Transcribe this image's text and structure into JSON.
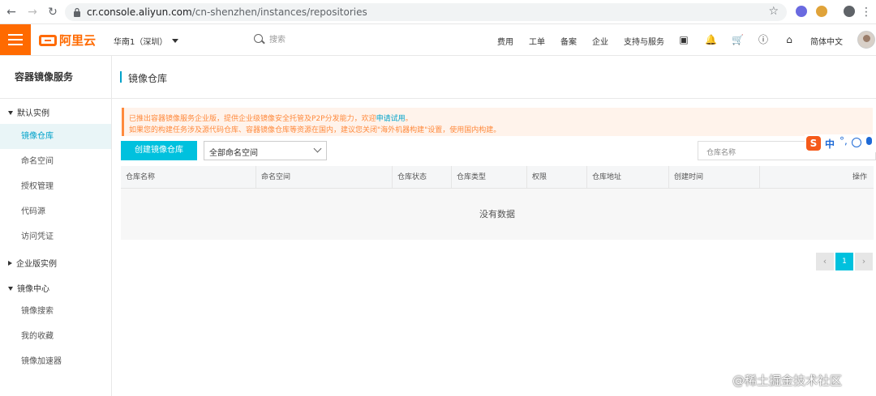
{
  "browser": {
    "url_host": "cr.console.aliyun.com",
    "url_path": "/cn-shenzhen/instances/repositories"
  },
  "header": {
    "logo_text": "阿里云",
    "region": "华南1（深圳）",
    "search_placeholder": "搜索",
    "links": [
      "费用",
      "工单",
      "备案",
      "企业",
      "支持与服务"
    ],
    "language": "简体中文"
  },
  "sidebar": {
    "title": "容器镜像服务",
    "groups": [
      {
        "label": "默认实例",
        "items": [
          "镜像仓库",
          "命名空间",
          "授权管理",
          "代码源",
          "访问凭证"
        ]
      },
      {
        "label": "企业版实例",
        "items": []
      },
      {
        "label": "镜像中心",
        "items": [
          "镜像搜索",
          "我的收藏",
          "镜像加速器"
        ]
      }
    ],
    "active_item": "镜像仓库"
  },
  "main": {
    "page_title": "镜像仓库",
    "notice_line1_prefix": "已推出容器镜像服务企业版，提供企业级镜像安全托管及P2P分发能力，欢迎",
    "notice_line1_link": "申请试用",
    "notice_line1_suffix": "。",
    "notice_line2": "如果您的构建任务涉及源代码仓库、容器镜像仓库等资源在国内，建议您关闭\"海外机器构建\"设置，使用国内构建。",
    "create_button": "创建镜像仓库",
    "namespace_select": "全部命名空间",
    "repo_search_placeholder": "仓库名称",
    "ime": {
      "brand": "S",
      "mode": "中",
      "punct": "°,"
    },
    "table_columns": [
      "仓库名称",
      "命名空间",
      "仓库状态",
      "仓库类型",
      "权限",
      "仓库地址",
      "创建时间",
      "操作"
    ],
    "empty_text": "没有数据",
    "pagination": {
      "current_page": "1"
    }
  },
  "watermark": "@稀土掘金技术社区",
  "colors": {
    "brand": "#ff6a00",
    "accent": "#00c1de",
    "notice_text": "#ff8a3d"
  }
}
